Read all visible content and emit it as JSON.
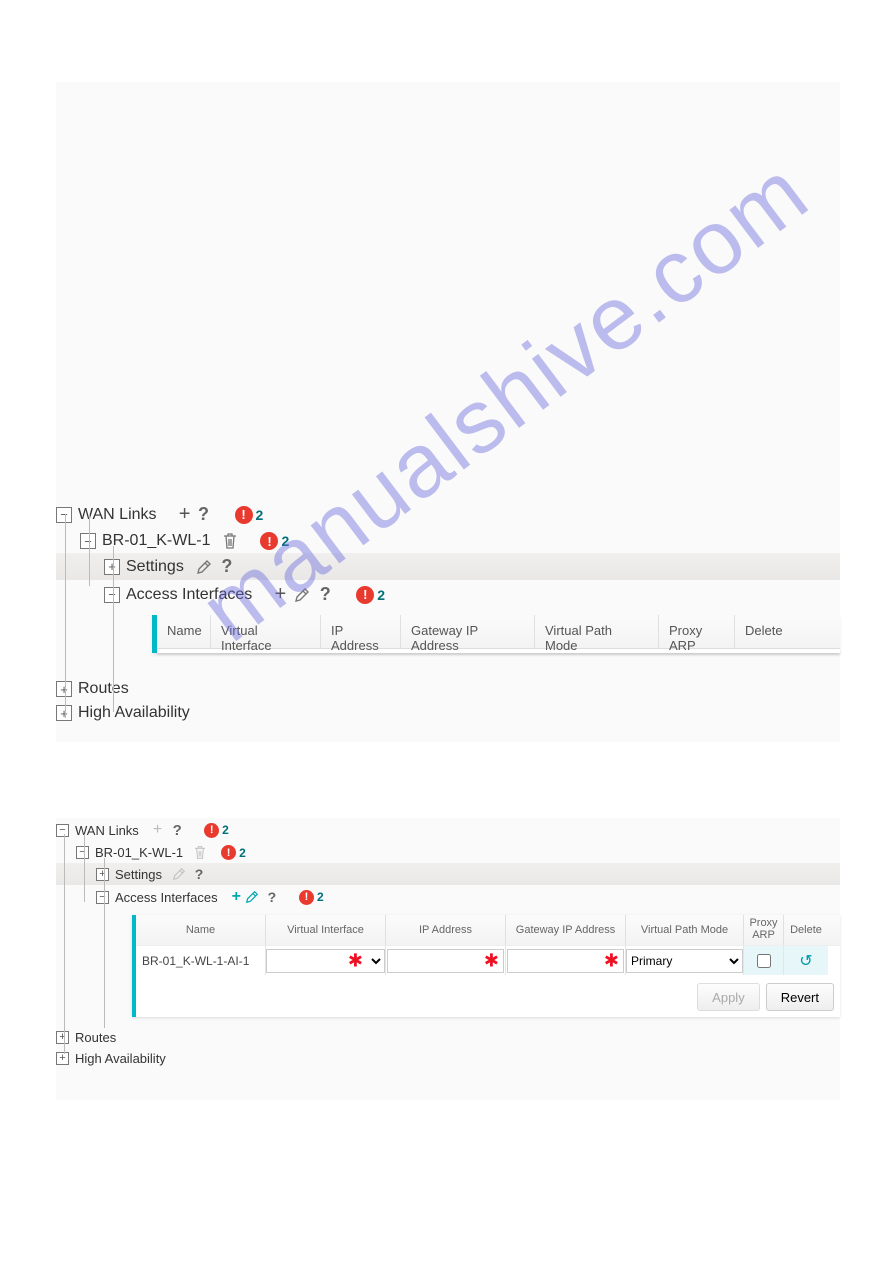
{
  "watermark": "manualshive.com",
  "alerts": {
    "count": "2"
  },
  "panel1": {
    "wan_links": {
      "label": "WAN Links"
    },
    "br": {
      "label": "BR-01_K-WL-1"
    },
    "settings": {
      "label": "Settings"
    },
    "access_if": {
      "label": "Access Interfaces"
    },
    "table": {
      "cols": {
        "name": "Name",
        "vif": "Virtual Interface",
        "ip": "IP Address",
        "gw": "Gateway IP Address",
        "vpm": "Virtual Path Mode",
        "parp": "Proxy ARP",
        "del": "Delete"
      }
    },
    "routes": {
      "label": "Routes"
    },
    "ha": {
      "label": "High Availability"
    }
  },
  "panel2": {
    "wan_links": {
      "label": "WAN Links"
    },
    "br": {
      "label": "BR-01_K-WL-1"
    },
    "settings": {
      "label": "Settings"
    },
    "access_if": {
      "label": "Access Interfaces"
    },
    "table": {
      "cols": {
        "name": "Name",
        "vif": "Virtual Interface",
        "ip": "IP Address",
        "gw": "Gateway IP Address",
        "vpm": "Virtual Path Mode",
        "parp": "Proxy\nARP",
        "del": "Delete"
      },
      "row": {
        "name": "BR-01_K-WL-1-AI-1",
        "vpm_selected": "Primary"
      }
    },
    "buttons": {
      "apply": "Apply",
      "revert": "Revert"
    },
    "routes": {
      "label": "Routes"
    },
    "ha": {
      "label": "High Availability"
    }
  }
}
